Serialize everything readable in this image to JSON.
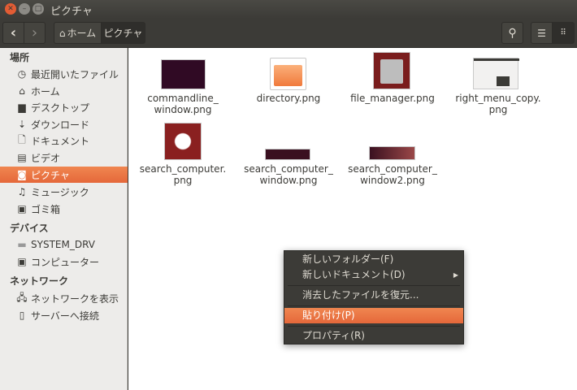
{
  "window": {
    "title": "ピクチャ"
  },
  "toolbar": {
    "back": "‹",
    "forward": "›",
    "breadcrumb": [
      {
        "label": "ホーム",
        "icon": "home-icon"
      },
      {
        "label": "ピクチャ"
      }
    ],
    "search_icon": "search-icon",
    "list_view_icon": "list-icon",
    "grid_view_icon": "grid-icon"
  },
  "sidebar": {
    "places_header": "場所",
    "places": [
      {
        "label": "最近開いたファイル",
        "icon": "clock-icon"
      },
      {
        "label": "ホーム",
        "icon": "home-icon"
      },
      {
        "label": "デスクトップ",
        "icon": "folder-icon"
      },
      {
        "label": "ダウンロード",
        "icon": "download-icon"
      },
      {
        "label": "ドキュメント",
        "icon": "document-icon"
      },
      {
        "label": "ビデオ",
        "icon": "film-icon"
      },
      {
        "label": "ピクチャ",
        "icon": "camera-icon",
        "active": true
      },
      {
        "label": "ミュージック",
        "icon": "music-icon"
      },
      {
        "label": "ゴミ箱",
        "icon": "trash-icon"
      }
    ],
    "devices_header": "デバイス",
    "devices": [
      {
        "label": "SYSTEM_DRV",
        "icon": "drive-icon"
      },
      {
        "label": "コンピューター",
        "icon": "computer-icon"
      }
    ],
    "network_header": "ネットワーク",
    "network": [
      {
        "label": "ネットワークを表示",
        "icon": "network-icon"
      },
      {
        "label": "サーバーへ接続",
        "icon": "server-icon"
      }
    ]
  },
  "files": [
    {
      "line1": "commandline_",
      "line2": "window.png"
    },
    {
      "line1": "directory.png",
      "line2": ""
    },
    {
      "line1": "file_manager.png",
      "line2": ""
    },
    {
      "line1": "right_menu_copy.",
      "line2": "png"
    },
    {
      "line1": "search_computer.",
      "line2": "png"
    },
    {
      "line1": "search_computer_",
      "line2": "window.png"
    },
    {
      "line1": "search_computer_",
      "line2": "window2.png"
    }
  ],
  "context_menu": {
    "items": [
      {
        "label": "新しいフォルダー(F)"
      },
      {
        "label": "新しいドキュメント(D)",
        "submenu": true
      },
      {
        "label": "消去したファイルを復元..."
      },
      {
        "label": "貼り付け(P)",
        "highlighted": true
      },
      {
        "label": "プロパティ(R)"
      }
    ]
  },
  "colors": {
    "accent": "#e95420",
    "titlebar": "#3c3b37",
    "sidebar": "#edecea"
  }
}
